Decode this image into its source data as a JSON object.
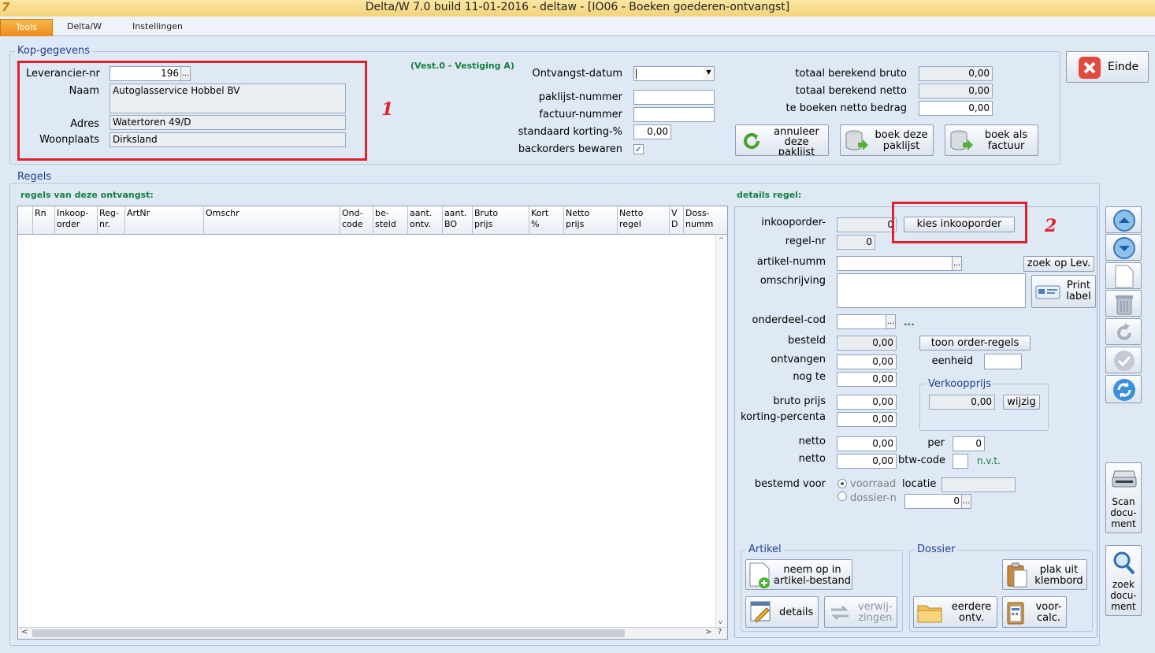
{
  "window": {
    "title": "Delta/W 7.0 build 11-01-2016 - deltaw - [IO06 - Boeken goederen-ontvangst]",
    "logo": "7"
  },
  "menu": {
    "tabs": [
      {
        "label": "Tools"
      },
      {
        "label": "Delta/W"
      },
      {
        "label": "Instellingen"
      }
    ],
    "active_tab": "Tools"
  },
  "kop": {
    "group_title": "Kop-gegevens",
    "leverancier_label": "Leverancier-nr",
    "leverancier_value": "196",
    "naam_label": "Naam",
    "naam_value": "Autoglasservice Hobbel BV",
    "adres_label": "Adres",
    "adres_value": "Watertoren 49/D",
    "woonplaats_label": "Woonplaats",
    "woonplaats_value": "Dirksland",
    "vestiging": "(Vest.0 - Vestiging A)",
    "ontvangst_datum_label": "Ontvangst-datum",
    "ontvangst_datum_value": "",
    "paklijst_label": "paklijst-nummer",
    "paklijst_value": "",
    "factuur_label": "factuur-nummer",
    "factuur_value": "",
    "korting_label": "standaard korting-%",
    "korting_value": "0,00",
    "backorders_label": "backorders bewaren",
    "backorders_checked": true,
    "bruto_label": "totaal berekend bruto",
    "bruto_value": "0,00",
    "netto_label": "totaal berekend netto",
    "netto_value": "0,00",
    "te_boeken_label": "te boeken netto bedrag",
    "te_boeken_value": "0,00",
    "btn_annuleer": [
      "annuleer",
      "deze",
      "paklijst"
    ],
    "btn_boek_paklijst": [
      "boek deze",
      "paklijst"
    ],
    "btn_boek_factuur": [
      "boek als",
      "factuur"
    ],
    "btn_einde": "Einde"
  },
  "regels": {
    "group_title": "Regels",
    "grid_title": "regels van deze ontvangst:",
    "columns": [
      "Rn",
      "Inkoop-\norder",
      "Reg-\nnr.",
      "ArtNr",
      "Omschr",
      "Ond-\ncode",
      "be-\nsteld",
      "aant.\nontv.",
      "aant.\nBO",
      "Bruto\nprijs",
      "Kort\n%",
      "Netto\nprijs",
      "Netto\nregel",
      "V\nD",
      "Doss-\nnumm"
    ],
    "scroll_left": "<",
    "scroll_right": ">",
    "scroll_q": "?",
    "scroll_up": "^",
    "scroll_down": "v"
  },
  "details": {
    "title": "details regel:",
    "inkooporder_label": "inkooporder-",
    "inkooporder_value": "0",
    "kies_btn": "kies inkooporder",
    "regelnr_label": "regel-nr",
    "regelnr_value": "0",
    "artikel_label": "artikel-numm",
    "artikel_value": "",
    "zoek_lev_btn": "zoek op Lev.",
    "omschrijving_label": "omschrijving",
    "omschrijving_value": "",
    "print_label_btn": [
      "Print",
      "label"
    ],
    "onderdeel_label": "onderdeel-cod",
    "onderdeel_value": "",
    "onderdeel_hint": "...",
    "besteld_label": "besteld",
    "besteld_value": "0,00",
    "toon_btn": "toon order-regels",
    "ontvangen_label": "ontvangen",
    "ontvangen_value": "0,00",
    "eenheid_label": "eenheid",
    "eenheid_value": "",
    "nogte_label": "nog te",
    "nogte_value": "0,00",
    "verkoop_title": "Verkoopprijs",
    "verkoop_value": "0,00",
    "wijzig_btn": "wijzig",
    "bruto_prijs_label": "bruto prijs",
    "bruto_prijs_value": "0,00",
    "korting_perc_label": "korting-percenta",
    "korting_perc_value": "0,00",
    "netto1_label": "netto",
    "netto1_value": "0,00",
    "per_label": "per",
    "per_value": "0",
    "netto2_label": "netto",
    "netto2_value": "0,00",
    "btw_label": "btw-code",
    "btw_value": "",
    "btw_hint": "n.v.t.",
    "bestemd_label": "bestemd voor",
    "voorraad_label": "voorraad",
    "dossier_label": "dossier-n",
    "dossier_value": "0",
    "locatie_label": "locatie",
    "locatie_value": ""
  },
  "artikel": {
    "group_title": "Artikel",
    "neem_btn": [
      "neem op in",
      "artikel-bestand"
    ],
    "details_btn": "details",
    "verwijzingen_btn": [
      "verwij-",
      "zingen"
    ]
  },
  "dossier": {
    "group_title": "Dossier",
    "plak_btn": [
      "plak uit",
      "klembord"
    ],
    "eerdere_btn": [
      "eerdere",
      "ontv."
    ],
    "voorcalc_btn": [
      "voor-",
      "calc."
    ]
  },
  "side": {
    "scan_btn": [
      "Scan",
      "docu-",
      "ment"
    ],
    "zoek_btn": [
      "zoek",
      "docu-",
      "ment"
    ]
  },
  "annotations": {
    "one": "1",
    "two": "2"
  }
}
